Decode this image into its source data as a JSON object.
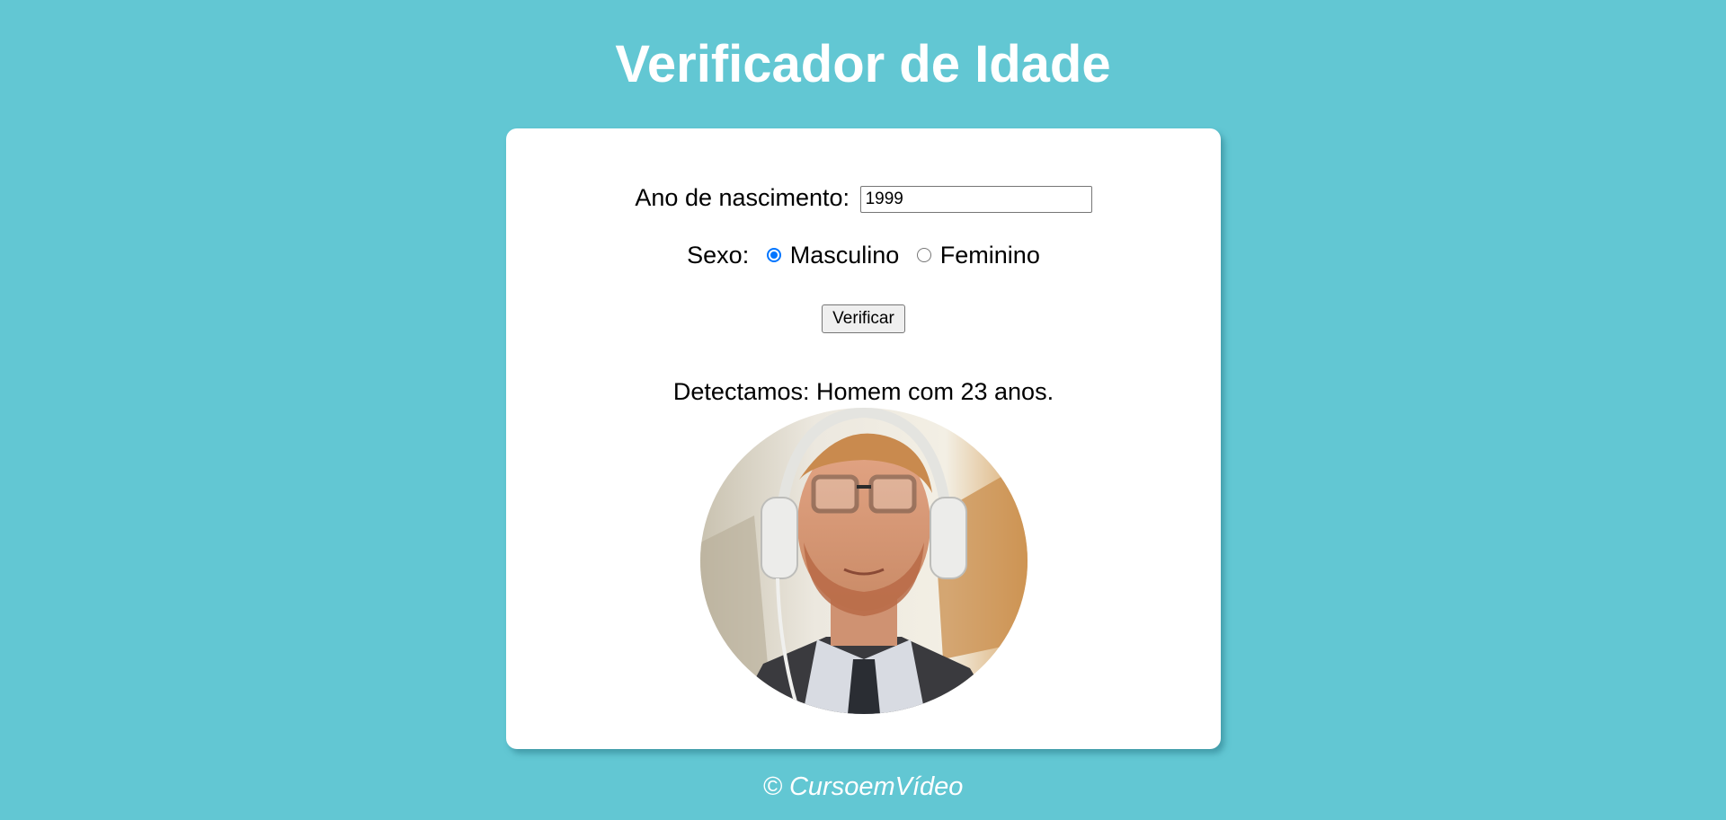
{
  "page": {
    "title": "Verificador de Idade",
    "background_color": "#62c7d3"
  },
  "form": {
    "birth_label": "Ano de nascimento:",
    "birth_value": "1999",
    "sex_label": "Sexo:",
    "sex_options": [
      {
        "label": "Masculino",
        "checked": true
      },
      {
        "label": "Feminino",
        "checked": false
      }
    ],
    "submit_label": "Verificar"
  },
  "result": {
    "text": "Detectamos: Homem com 23 anos."
  },
  "photo": {
    "description_icon": "man-with-headphones-photo"
  },
  "footer": {
    "text": "© CursoemVídeo"
  },
  "colors": {
    "accent": "#0075ff",
    "card": "#ffffff",
    "title": "#ffffff"
  }
}
